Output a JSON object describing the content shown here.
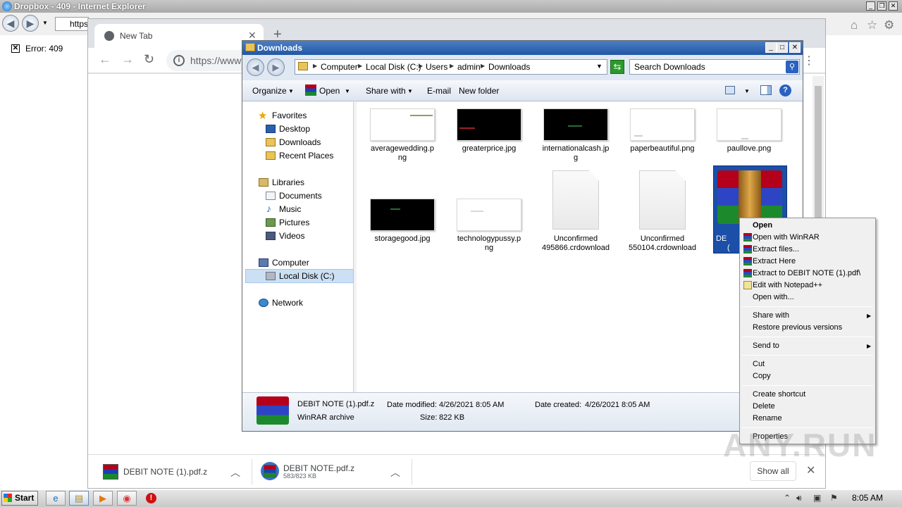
{
  "ie": {
    "title": "Dropbox - 409 - Internet Explorer",
    "address_text": "https",
    "error_text": "Error: 409",
    "error_icon": "x-box-icon"
  },
  "chrome": {
    "tab_title": "New Tab",
    "url_text": "https://www",
    "downloads": [
      {
        "name": "DEBIT NOTE (1).pdf.z",
        "sub": ""
      },
      {
        "name": "DEBIT NOTE.pdf.z",
        "sub": "583/823 KB"
      }
    ],
    "show_all": "Show all"
  },
  "explorer": {
    "title": "Downloads",
    "breadcrumbs": [
      "Computer",
      "Local Disk (C:)",
      "Users",
      "admin",
      "Downloads"
    ],
    "search_placeholder": "Search Downloads",
    "commands": {
      "organize": "Organize",
      "open": "Open",
      "share_with": "Share with",
      "email": "E-mail",
      "new_folder": "New folder"
    },
    "nav": {
      "favorites": "Favorites",
      "desktop": "Desktop",
      "downloads": "Downloads",
      "recent": "Recent Places",
      "libraries": "Libraries",
      "documents": "Documents",
      "music": "Music",
      "pictures": "Pictures",
      "videos": "Videos",
      "computer": "Computer",
      "local_disk": "Local Disk (C:)",
      "network": "Network"
    },
    "files": [
      {
        "line1": "averagewedding.p",
        "line2": "ng",
        "thumb": "light"
      },
      {
        "line1": "greaterprice.jpg",
        "line2": "",
        "thumb": "dark"
      },
      {
        "line1": "internationalcash.jp",
        "line2": "g",
        "thumb": "dark"
      },
      {
        "line1": "paperbeautiful.png",
        "line2": "",
        "thumb": "light"
      },
      {
        "line1": "paullove.png",
        "line2": "",
        "thumb": "light"
      },
      {
        "line1": "storagegood.jpg",
        "line2": "",
        "thumb": "dark"
      },
      {
        "line1": "technologypussy.p",
        "line2": "ng",
        "thumb": "light"
      },
      {
        "line1": "Unconfirmed",
        "line2": "495866.crdownload",
        "thumb": "doc"
      },
      {
        "line1": "Unconfirmed",
        "line2": "550104.crdownload",
        "thumb": "doc"
      },
      {
        "line1": "DE",
        "line2": "(",
        "thumb": "winrar"
      }
    ],
    "details": {
      "name": "DEBIT NOTE (1).pdf.z",
      "type": "WinRAR archive",
      "date_modified_label": "Date modified:",
      "date_modified": "4/26/2021 8:05 AM",
      "date_created_label": "Date created:",
      "date_created": "4/26/2021 8:05 AM",
      "size_label": "Size:",
      "size": "822 KB"
    }
  },
  "context_menu": {
    "open": "Open",
    "open_winrar": "Open with WinRAR",
    "extract_files": "Extract files...",
    "extract_here": "Extract Here",
    "extract_to": "Extract to DEBIT NOTE (1).pdf\\",
    "edit_notepad": "Edit with Notepad++",
    "open_with": "Open with...",
    "share_with": "Share with",
    "restore": "Restore previous versions",
    "send_to": "Send to",
    "cut": "Cut",
    "copy": "Copy",
    "create_shortcut": "Create shortcut",
    "delete": "Delete",
    "rename": "Rename",
    "properties": "Properties"
  },
  "watermark": "ANY.RUN",
  "taskbar": {
    "start": "Start",
    "clock": "8:05 AM"
  }
}
